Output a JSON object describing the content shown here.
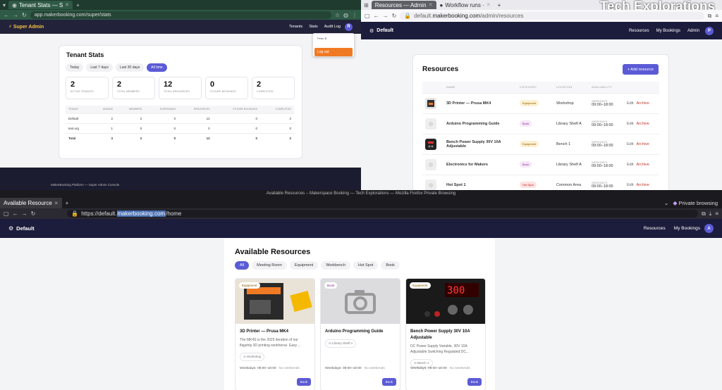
{
  "pane1": {
    "tab": "Tenant Stats — S",
    "url": "app.makerbooking.com/super/stats",
    "brand": "⚡ Super Admin",
    "nav": [
      "Tenants",
      "Stats",
      "Audit Log"
    ],
    "avatar": "R",
    "dropdown": {
      "user": "Peter B",
      "logout": "Log out"
    },
    "title": "Tenant Stats",
    "filters": [
      "Today",
      "Last 7 days",
      "Last 30 days",
      "All time"
    ],
    "stats": [
      {
        "num": "2",
        "lbl": "ACTIVE TENANTS"
      },
      {
        "num": "2",
        "lbl": "TOTAL MEMBERS"
      },
      {
        "num": "12",
        "lbl": "TOTAL RESOURCES"
      },
      {
        "num": "0",
        "lbl": "FUTURE BOOKINGS"
      },
      {
        "num": "2",
        "lbl": "COMPLETED"
      }
    ],
    "columns": [
      "TENANT",
      "ADMINS",
      "MEMBERS",
      "SUSPENDED",
      "RESOURCES",
      "FUTURE BOOKINGS",
      "COMPLETED"
    ],
    "rows": [
      [
        "Default",
        "2",
        "2",
        "0",
        "12",
        "0",
        "2"
      ],
      [
        "test.org",
        "1",
        "0",
        "0",
        "0",
        "0",
        "0"
      ],
      [
        "Total",
        "3",
        "2",
        "0",
        "12",
        "0",
        "2"
      ]
    ],
    "footer": "MakerBooking Platform — Super Admin Console"
  },
  "pane2": {
    "tabs": [
      "Resources — Admin",
      "Workflow runs · "
    ],
    "url_pre": "default.",
    "url_host": "makerbooking.com",
    "url_post": "/admin/resources",
    "brand": "Default",
    "nav": [
      "Resources",
      "My Bookings",
      "Admin"
    ],
    "avatar": "P",
    "title": "Resources",
    "add_label": "+ Add resource",
    "columns": [
      "",
      "NAME",
      "CATEGORY",
      "LOCATION",
      "AVAILABILITY",
      ""
    ],
    "rows": [
      {
        "name": "3D Printer — Prusa MK4",
        "cat": "Equipment",
        "loc": "Workshop",
        "days": "WEEKDAYS",
        "hours": "09:00–18:00"
      },
      {
        "name": "Arduino Programming Guide",
        "cat": "Book",
        "loc": "Library Shelf A",
        "days": "WEEKDAYS",
        "hours": "09:00–18:00"
      },
      {
        "name": "Bench Power Supply 30V 10A Adjustable",
        "cat": "Equipment",
        "loc": "Bench 1",
        "days": "WEEKDAYS",
        "hours": "09:00–18:00"
      },
      {
        "name": "Electronics for Makers",
        "cat": "Book",
        "loc": "Library Shelf A",
        "days": "WEEKDAYS",
        "hours": "09:00–18:00"
      },
      {
        "name": "Hot Spot 1",
        "cat": "Hot Spot",
        "loc": "Common Area",
        "days": "WEEKDAYS",
        "hours": "09:00–18:00"
      }
    ],
    "edit": "Edit",
    "archive": "Archive",
    "logo": "Tech Explorations"
  },
  "pane3": {
    "window_title": "Available Resources – Makerspace Booking — Tech Explorations — Mozilla Firefox Private Browsing",
    "tab": "Available Resource",
    "private": "Private browsing",
    "url_pre": "https://default.",
    "url_host": "makerbooking.com",
    "url_post": "/home",
    "brand": "Default",
    "nav": [
      "Resources",
      "My Bookings"
    ],
    "avatar": "A",
    "title": "Available Resources",
    "chips": [
      "All",
      "Meeting Room",
      "Equipment",
      "Workbench",
      "Hot Spot",
      "Book"
    ],
    "cards": [
      {
        "tag": "Equipment",
        "name": "3D Printer — Prusa MK4",
        "desc": "The MK4S is the 2025 iteration of our flagship 3D printing workhorse. Easy ...",
        "loc": "Workshop",
        "hours": "Weekdays: 09:00–18:00",
        "weekend": "No weekends",
        "book": "Book"
      },
      {
        "tag": "Book",
        "name": "Arduino Programming Guide",
        "desc": "",
        "loc": "Library Shelf A",
        "hours": "Weekdays: 09:00–18:00",
        "weekend": "No weekends",
        "book": "Book"
      },
      {
        "tag": "Equipment",
        "name": "Bench Power Supply 30V 10A Adjustable",
        "desc": "DC Power Supply Variable, 30V 10A Adjustable Switching Regulated DC...",
        "loc": "Bench 1",
        "hours": "Weekdays: 09:00–18:00",
        "weekend": "No weekends",
        "book": "Book"
      }
    ]
  }
}
